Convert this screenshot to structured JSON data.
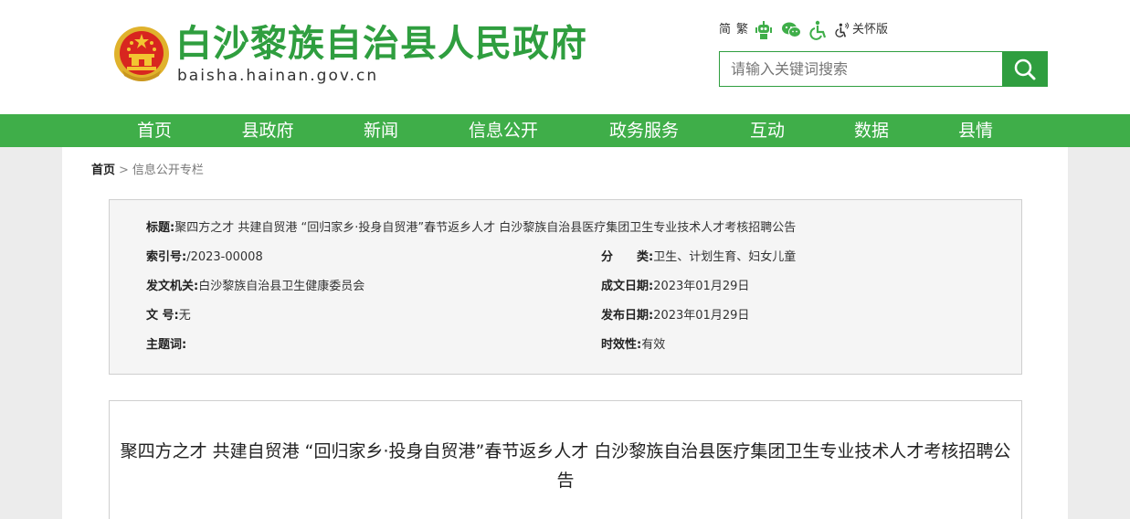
{
  "header": {
    "title": "白沙黎族自治县人民政府",
    "domain": "baisha.hainan.gov.cn",
    "tools": {
      "simplified": "简",
      "traditional": "繁",
      "elderly_version": "关怀版"
    },
    "search": {
      "placeholder": "请输入关键词搜索"
    },
    "colors": {
      "brand_green": "#2f9e3f",
      "nav_green": "#3fae49"
    }
  },
  "nav": {
    "items": [
      {
        "label": "首页"
      },
      {
        "label": "县政府"
      },
      {
        "label": "新闻"
      },
      {
        "label": "信息公开"
      },
      {
        "label": "政务服务"
      },
      {
        "label": "互动"
      },
      {
        "label": "数据"
      },
      {
        "label": "县情"
      }
    ]
  },
  "breadcrumb": {
    "home": "首页",
    "separator": ">",
    "current": "信息公开专栏"
  },
  "meta": {
    "title_label": "标题:",
    "title_value": "聚四方之才 共建自贸港 “回归家乡·投身自贸港”春节返乡人才 白沙黎族自治县医疗集团卫生专业技术人才考核招聘公告",
    "index_label": "索引号:",
    "index_value": "/2023-00008",
    "category_label": "分　　类:",
    "category_value": "卫生、计划生育、妇女儿童",
    "issuer_label": "发文机关:",
    "issuer_value": "白沙黎族自治县卫生健康委员会",
    "created_label": "成文日期:",
    "created_value": "2023年01月29日",
    "docno_label": "文 号:",
    "docno_value": "无",
    "published_label": "发布日期:",
    "published_value": "2023年01月29日",
    "subject_label": "主题词:",
    "subject_value": "",
    "validity_label": "时效性:",
    "validity_value": "有效"
  },
  "article": {
    "title": "聚四方之才 共建自贸港 “回归家乡·投身自贸港”春节返乡人才 白沙黎族自治县医疗集团卫生专业技术人才考核招聘公告"
  }
}
